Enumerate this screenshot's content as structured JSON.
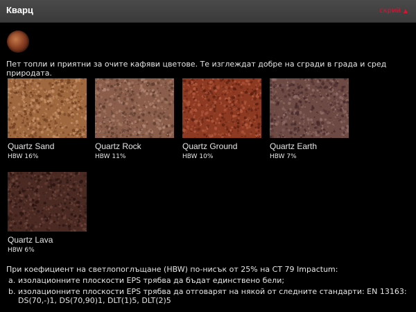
{
  "header": {
    "title": "Кварц",
    "hide_label": "скрий",
    "arrow_icon": "▲"
  },
  "logo": {
    "name": "quartz-swatch-logo"
  },
  "intro": "Пет топли и приятни за очите кафяви цветове. Те изглеждат добре на сгради в града и сред природата.",
  "swatches": [
    {
      "name": "Quartz Sand",
      "hbw": "HBW 16%",
      "color_base": "#a0683e",
      "color_hi": "#c7926a",
      "color_lo": "#6e3f20"
    },
    {
      "name": "Quartz Rock",
      "hbw": "HBW 11%",
      "color_base": "#8a5e4a",
      "color_hi": "#b08672",
      "color_lo": "#5a3a2c"
    },
    {
      "name": "Quartz Ground",
      "hbw": "HBW 10%",
      "color_base": "#8e3a22",
      "color_hi": "#b85e42",
      "color_lo": "#5a1f10"
    },
    {
      "name": "Quartz Earth",
      "hbw": "HBW 7%",
      "color_base": "#6e4a44",
      "color_hi": "#93706a",
      "color_lo": "#45292a"
    },
    {
      "name": "Quartz Lava",
      "hbw": "HBW 6%",
      "color_base": "#4a2a22",
      "color_hi": "#6e463c",
      "color_lo": "#2a1410"
    }
  ],
  "notes": {
    "intro": "При коефициент на светлопоглъщане (HBW) по-нисък от 25% на СТ 79 Impactum:",
    "items": [
      {
        "marker": "a.",
        "text": "изолационните плоскости EPS трябва да бъдат единствено бели;"
      },
      {
        "marker": "b.",
        "text": "изолационните плоскости EPS трябва да отговарят на някой от следните стандарти: EN 13163: DS(70,-)1, DS(70,90)1, DLT(1)5, DLT(2)5"
      }
    ]
  }
}
